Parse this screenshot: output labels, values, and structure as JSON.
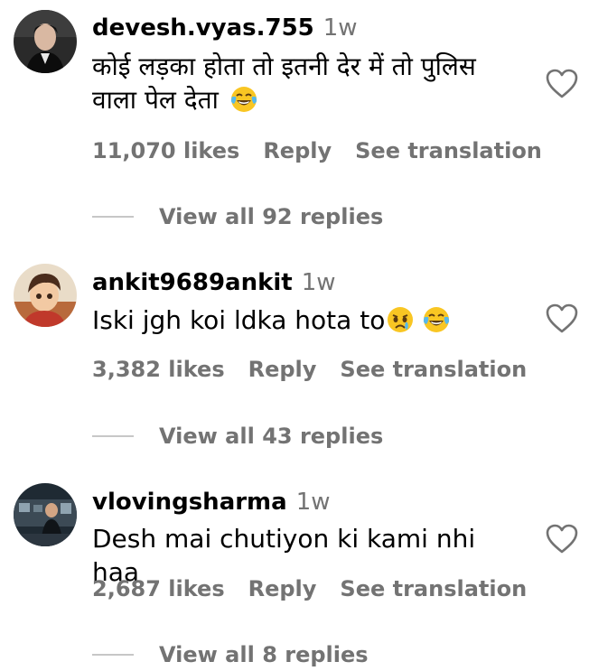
{
  "comments": [
    {
      "username": "devesh.vyas.755",
      "time": "1w",
      "text": "कोई लड़का होता तो इतनी देर में तो पुलिस वाला पेल देता",
      "emojis": [
        "face-with-tears-of-joy"
      ],
      "likes": "11,070 likes",
      "reply": "Reply",
      "translation": "See translation",
      "view_replies": "View all 92 replies"
    },
    {
      "username": "ankit9689ankit",
      "time": "1w",
      "text": "Iski jgh koi ldka hota to",
      "emojis": [
        "crying-face",
        "face-with-tears-of-joy"
      ],
      "likes": "3,382 likes",
      "reply": "Reply",
      "translation": "See translation",
      "view_replies": "View all 43 replies"
    },
    {
      "username": "vlovingsharma",
      "time": "1w",
      "text": "Desh mai chutiyon ki kami nhi haa",
      "emojis": [],
      "likes": "2,687 likes",
      "reply": "Reply",
      "translation": "See translation",
      "view_replies": "View all 8 replies"
    }
  ],
  "colors": {
    "text": "#000000",
    "secondary": "#737373",
    "divider": "#c7c7c7",
    "emoji_yellow": "#f9c623"
  }
}
